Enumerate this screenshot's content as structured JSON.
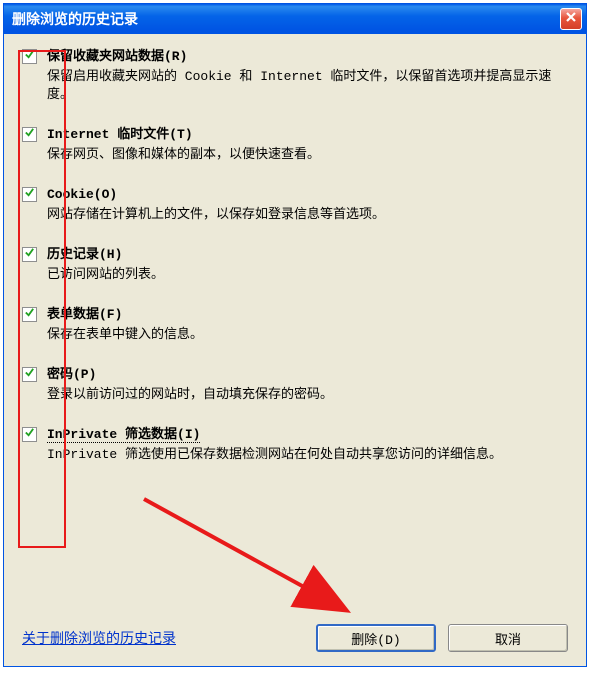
{
  "window": {
    "title": "删除浏览的历史记录"
  },
  "options": [
    {
      "checked": true,
      "label": "保留收藏夹网站数据(R)",
      "desc": "保留启用收藏夹网站的 Cookie 和 Internet 临时文件，以保留首选项并提高显示速度。"
    },
    {
      "checked": true,
      "label": "Internet 临时文件(T)",
      "desc": "保存网页、图像和媒体的副本，以便快速查看。"
    },
    {
      "checked": true,
      "label": "Cookie(O)",
      "desc": "网站存储在计算机上的文件，以保存如登录信息等首选项。"
    },
    {
      "checked": true,
      "label": "历史记录(H)",
      "desc": "已访问网站的列表。"
    },
    {
      "checked": true,
      "label": "表单数据(F)",
      "desc": "保存在表单中键入的信息。"
    },
    {
      "checked": true,
      "label": "密码(P)",
      "desc": "登录以前访问过的网站时，自动填充保存的密码。"
    },
    {
      "checked": true,
      "label": "InPrivate 筛选数据(I)",
      "desc": "InPrivate 筛选使用已保存数据检测网站在何处自动共享您访问的详细信息。"
    }
  ],
  "footer": {
    "link": "关于删除浏览的历史记录",
    "delete_btn": "删除(D)",
    "cancel_btn": "取消"
  }
}
